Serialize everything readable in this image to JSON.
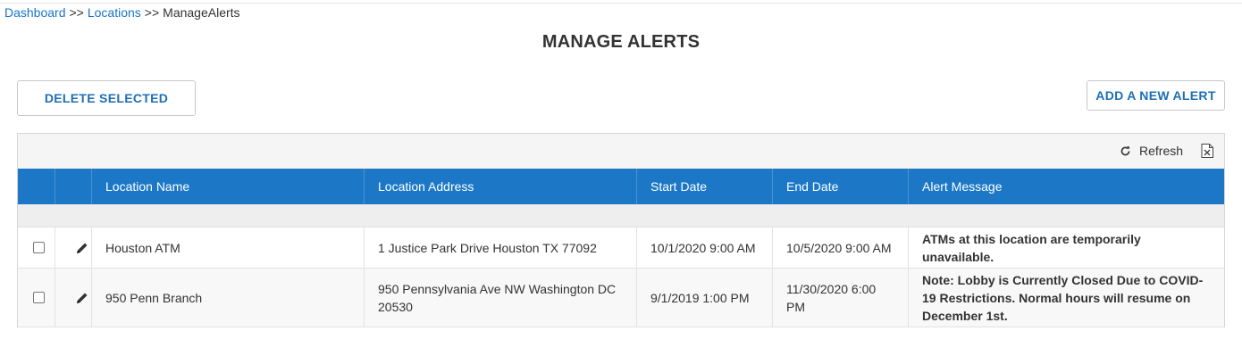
{
  "breadcrumb": {
    "items": [
      "Dashboard",
      "Locations",
      "ManageAlerts"
    ],
    "separator": ">>"
  },
  "page": {
    "title": "MANAGE ALERTS"
  },
  "actions": {
    "delete_label": "DELETE SELECTED",
    "add_label": "ADD A NEW ALERT"
  },
  "toolbar": {
    "refresh_label": "Refresh"
  },
  "table": {
    "columns": [
      "Location Name",
      "Location Address",
      "Start Date",
      "End Date",
      "Alert Message"
    ],
    "rows": [
      {
        "location_name": "Houston ATM",
        "location_address": "1 Justice Park Drive Houston TX 77092",
        "start_date": "10/1/2020 9:00 AM",
        "end_date": "10/5/2020 9:00 AM",
        "alert_message": "ATMs at this location are temporarily unavailable."
      },
      {
        "location_name": "950 Penn Branch",
        "location_address": "950 Pennsylvania Ave NW Washington DC 20530",
        "start_date": "9/1/2019 1:00 PM",
        "end_date": "11/30/2020 6:00 PM",
        "alert_message": "Note: Lobby is Currently Closed Due to COVID-19 Restrictions. Normal hours will resume on December 1st."
      }
    ]
  },
  "colors": {
    "link": "#1a73c9",
    "header_bg": "#1c78c7",
    "button_text": "#1e6fb3",
    "alert_red": "#c00000"
  },
  "icons": {
    "refresh": "refresh-icon",
    "export": "excel-export-icon",
    "edit": "pencil-icon"
  }
}
